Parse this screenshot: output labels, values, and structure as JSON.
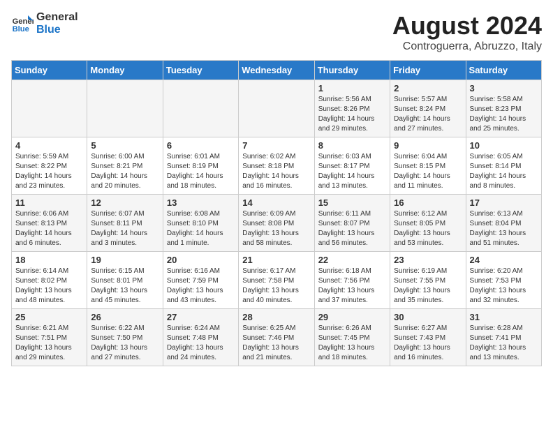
{
  "logo": {
    "line1": "General",
    "line2": "Blue"
  },
  "title": {
    "month_year": "August 2024",
    "location": "Controguerra, Abruzzo, Italy"
  },
  "days_of_week": [
    "Sunday",
    "Monday",
    "Tuesday",
    "Wednesday",
    "Thursday",
    "Friday",
    "Saturday"
  ],
  "weeks": [
    [
      {
        "day": "",
        "info": ""
      },
      {
        "day": "",
        "info": ""
      },
      {
        "day": "",
        "info": ""
      },
      {
        "day": "",
        "info": ""
      },
      {
        "day": "1",
        "info": "Sunrise: 5:56 AM\nSunset: 8:26 PM\nDaylight: 14 hours\nand 29 minutes."
      },
      {
        "day": "2",
        "info": "Sunrise: 5:57 AM\nSunset: 8:24 PM\nDaylight: 14 hours\nand 27 minutes."
      },
      {
        "day": "3",
        "info": "Sunrise: 5:58 AM\nSunset: 8:23 PM\nDaylight: 14 hours\nand 25 minutes."
      }
    ],
    [
      {
        "day": "4",
        "info": "Sunrise: 5:59 AM\nSunset: 8:22 PM\nDaylight: 14 hours\nand 23 minutes."
      },
      {
        "day": "5",
        "info": "Sunrise: 6:00 AM\nSunset: 8:21 PM\nDaylight: 14 hours\nand 20 minutes."
      },
      {
        "day": "6",
        "info": "Sunrise: 6:01 AM\nSunset: 8:19 PM\nDaylight: 14 hours\nand 18 minutes."
      },
      {
        "day": "7",
        "info": "Sunrise: 6:02 AM\nSunset: 8:18 PM\nDaylight: 14 hours\nand 16 minutes."
      },
      {
        "day": "8",
        "info": "Sunrise: 6:03 AM\nSunset: 8:17 PM\nDaylight: 14 hours\nand 13 minutes."
      },
      {
        "day": "9",
        "info": "Sunrise: 6:04 AM\nSunset: 8:15 PM\nDaylight: 14 hours\nand 11 minutes."
      },
      {
        "day": "10",
        "info": "Sunrise: 6:05 AM\nSunset: 8:14 PM\nDaylight: 14 hours\nand 8 minutes."
      }
    ],
    [
      {
        "day": "11",
        "info": "Sunrise: 6:06 AM\nSunset: 8:13 PM\nDaylight: 14 hours\nand 6 minutes."
      },
      {
        "day": "12",
        "info": "Sunrise: 6:07 AM\nSunset: 8:11 PM\nDaylight: 14 hours\nand 3 minutes."
      },
      {
        "day": "13",
        "info": "Sunrise: 6:08 AM\nSunset: 8:10 PM\nDaylight: 14 hours\nand 1 minute."
      },
      {
        "day": "14",
        "info": "Sunrise: 6:09 AM\nSunset: 8:08 PM\nDaylight: 13 hours\nand 58 minutes."
      },
      {
        "day": "15",
        "info": "Sunrise: 6:11 AM\nSunset: 8:07 PM\nDaylight: 13 hours\nand 56 minutes."
      },
      {
        "day": "16",
        "info": "Sunrise: 6:12 AM\nSunset: 8:05 PM\nDaylight: 13 hours\nand 53 minutes."
      },
      {
        "day": "17",
        "info": "Sunrise: 6:13 AM\nSunset: 8:04 PM\nDaylight: 13 hours\nand 51 minutes."
      }
    ],
    [
      {
        "day": "18",
        "info": "Sunrise: 6:14 AM\nSunset: 8:02 PM\nDaylight: 13 hours\nand 48 minutes."
      },
      {
        "day": "19",
        "info": "Sunrise: 6:15 AM\nSunset: 8:01 PM\nDaylight: 13 hours\nand 45 minutes."
      },
      {
        "day": "20",
        "info": "Sunrise: 6:16 AM\nSunset: 7:59 PM\nDaylight: 13 hours\nand 43 minutes."
      },
      {
        "day": "21",
        "info": "Sunrise: 6:17 AM\nSunset: 7:58 PM\nDaylight: 13 hours\nand 40 minutes."
      },
      {
        "day": "22",
        "info": "Sunrise: 6:18 AM\nSunset: 7:56 PM\nDaylight: 13 hours\nand 37 minutes."
      },
      {
        "day": "23",
        "info": "Sunrise: 6:19 AM\nSunset: 7:55 PM\nDaylight: 13 hours\nand 35 minutes."
      },
      {
        "day": "24",
        "info": "Sunrise: 6:20 AM\nSunset: 7:53 PM\nDaylight: 13 hours\nand 32 minutes."
      }
    ],
    [
      {
        "day": "25",
        "info": "Sunrise: 6:21 AM\nSunset: 7:51 PM\nDaylight: 13 hours\nand 29 minutes."
      },
      {
        "day": "26",
        "info": "Sunrise: 6:22 AM\nSunset: 7:50 PM\nDaylight: 13 hours\nand 27 minutes."
      },
      {
        "day": "27",
        "info": "Sunrise: 6:24 AM\nSunset: 7:48 PM\nDaylight: 13 hours\nand 24 minutes."
      },
      {
        "day": "28",
        "info": "Sunrise: 6:25 AM\nSunset: 7:46 PM\nDaylight: 13 hours\nand 21 minutes."
      },
      {
        "day": "29",
        "info": "Sunrise: 6:26 AM\nSunset: 7:45 PM\nDaylight: 13 hours\nand 18 minutes."
      },
      {
        "day": "30",
        "info": "Sunrise: 6:27 AM\nSunset: 7:43 PM\nDaylight: 13 hours\nand 16 minutes."
      },
      {
        "day": "31",
        "info": "Sunrise: 6:28 AM\nSunset: 7:41 PM\nDaylight: 13 hours\nand 13 minutes."
      }
    ]
  ]
}
